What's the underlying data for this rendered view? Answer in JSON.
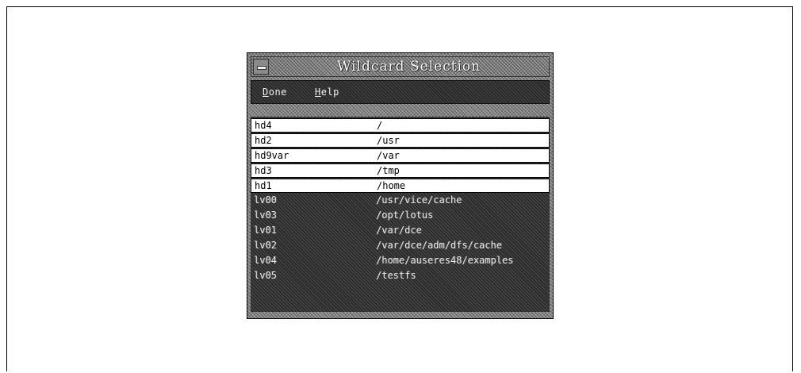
{
  "dialog": {
    "title": "Wildcard Selection",
    "window_menu_icon": "window-menu-icon"
  },
  "menubar": {
    "items": [
      {
        "label_mnemonic": "D",
        "label_rest": "one"
      },
      {
        "label_mnemonic": "H",
        "label_rest": "elp"
      }
    ]
  },
  "list": {
    "rows": [
      {
        "name": "hd4",
        "path": "/",
        "selected": true
      },
      {
        "name": "hd2",
        "path": "/usr",
        "selected": true
      },
      {
        "name": "hd9var",
        "path": "/var",
        "selected": true
      },
      {
        "name": "hd3",
        "path": "/tmp",
        "selected": true
      },
      {
        "name": "hd1",
        "path": "/home",
        "selected": true
      },
      {
        "name": "lv00",
        "path": "/usr/vice/cache",
        "selected": false
      },
      {
        "name": "lv03",
        "path": "/opt/lotus",
        "selected": false
      },
      {
        "name": "lv01",
        "path": "/var/dce",
        "selected": false
      },
      {
        "name": "lv02",
        "path": "/var/dce/adm/dfs/cache",
        "selected": false
      },
      {
        "name": "lv04",
        "path": "/home/auseres48/examples",
        "selected": false
      },
      {
        "name": "lv05",
        "path": "/testfs",
        "selected": false
      }
    ]
  }
}
